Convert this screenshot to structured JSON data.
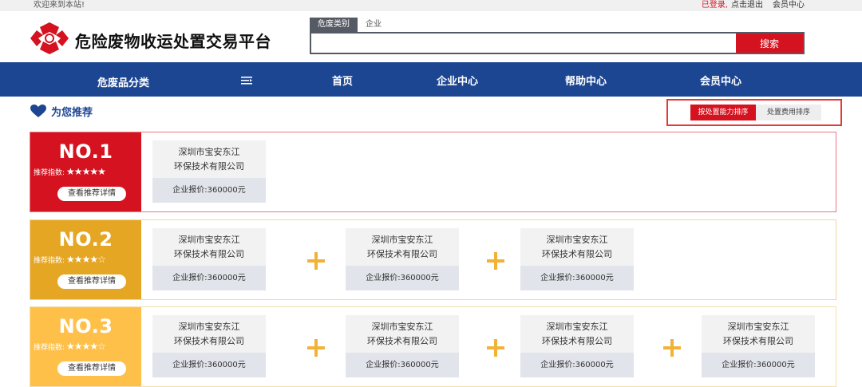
{
  "topbar": {
    "welcome": "欢迎来到本站!",
    "logged": "已登录,",
    "logout": "点击退出",
    "member": "会员中心"
  },
  "brand": {
    "name": "危险废物收运处置交易平台"
  },
  "search": {
    "tab_active": "危废类别",
    "tab_other": "企业",
    "placeholder": "",
    "button": "搜索"
  },
  "nav": {
    "category": "危废品分类",
    "items": [
      "首页",
      "企业中心",
      "帮助中心",
      "会员中心"
    ]
  },
  "recommend": {
    "title": "为您推荐"
  },
  "sort": {
    "by_capacity": "按处置能力排序",
    "by_cost": "处置费用排序"
  },
  "rows": [
    {
      "rank": "NO.1",
      "index_label": "推荐指数:",
      "stars": "★★★★★",
      "detail": "查看推荐详情",
      "cards": [
        {
          "line1": "深圳市宝安东江",
          "line2": "环保技术有限公司",
          "price": "企业报价:360000元"
        }
      ]
    },
    {
      "rank": "NO.2",
      "index_label": "推荐指数:",
      "stars": "★★★★☆",
      "detail": "查看推荐详情",
      "cards": [
        {
          "line1": "深圳市宝安东江",
          "line2": "环保技术有限公司",
          "price": "企业报价:360000元"
        },
        {
          "line1": "深圳市宝安东江",
          "line2": "环保技术有限公司",
          "price": "企业报价:360000元"
        },
        {
          "line1": "深圳市宝安东江",
          "line2": "环保技术有限公司",
          "price": "企业报价:360000元"
        }
      ]
    },
    {
      "rank": "NO.3",
      "index_label": "推荐指数:",
      "stars": "★★★★☆",
      "detail": "查看推荐详情",
      "cards": [
        {
          "line1": "深圳市宝安东江",
          "line2": "环保技术有限公司",
          "price": "企业报价:360000元"
        },
        {
          "line1": "深圳市宝安东江",
          "line2": "环保技术有限公司",
          "price": "企业报价:360000元"
        },
        {
          "line1": "深圳市宝安东江",
          "line2": "环保技术有限公司",
          "price": "企业报价:360000元"
        },
        {
          "line1": "深圳市宝安东江",
          "line2": "环保技术有限公司",
          "price": "企业报价:360000元"
        }
      ]
    }
  ],
  "colors": {
    "brand_red": "#d5121f",
    "nav_blue": "#1d4692",
    "rank1": "#d5121f",
    "rank2": "#e5a624",
    "rank3": "#ffc04a"
  }
}
